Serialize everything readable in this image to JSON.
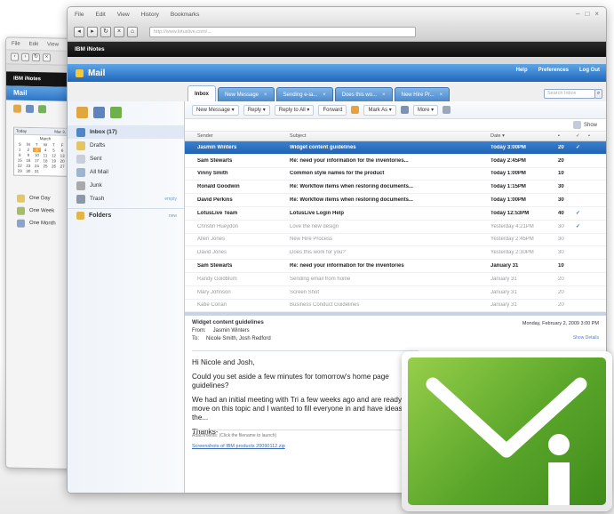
{
  "back_window": {
    "menu": [
      "File",
      "Edit",
      "View"
    ],
    "brand": "IBM iNotes",
    "header": "Mail",
    "date_tab": "Today",
    "date_label": "Mar 3, 20...",
    "calendar_month": "March",
    "calendar_days": [
      "S",
      "M",
      "T",
      "W",
      "T",
      "F",
      "S",
      "1",
      "2",
      "3",
      "4",
      "5",
      "6",
      "7",
      "8",
      "9",
      "10",
      "11",
      "12",
      "13",
      "14",
      "15",
      "16",
      "17",
      "18",
      "19",
      "20",
      "21",
      "22",
      "23",
      "24",
      "25",
      "26",
      "27",
      "28",
      "29",
      "30",
      "31"
    ],
    "views": [
      "One Day",
      "One Week",
      "One Month"
    ]
  },
  "browser": {
    "menu": [
      "File",
      "Edit",
      "View",
      "History",
      "Bookmarks"
    ],
    "url": "http://www.lotuslive.com/..."
  },
  "app": {
    "brand": "IBM iNotes",
    "title": "Mail",
    "util_links": [
      "Help",
      "Preferences",
      "Log Out"
    ],
    "search_placeholder": "Search Inbox"
  },
  "tabs": [
    {
      "label": "Inbox",
      "active": true
    },
    {
      "label": "New Message",
      "active": false
    },
    {
      "label": "Sending e-ia...",
      "active": false
    },
    {
      "label": "Does this wo...",
      "active": false
    },
    {
      "label": "New Hire Pr...",
      "active": false
    }
  ],
  "toolbar": {
    "new_message": "New Message",
    "reply": "Reply",
    "reply_all": "Reply to All",
    "forward": "Forward",
    "mark_as": "Mark As",
    "more": "More",
    "show": "Show"
  },
  "folders": [
    {
      "label": "Inbox (17)",
      "active": true
    },
    {
      "label": "Drafts",
      "active": false
    },
    {
      "label": "Sent",
      "active": false
    },
    {
      "label": "All Mail",
      "active": false
    },
    {
      "label": "Junk",
      "active": false
    },
    {
      "label": "Trash",
      "active": false
    }
  ],
  "trash_extra": "empty",
  "folders_header": "Folders",
  "folders_new": "new",
  "columns": {
    "sender": "Sender",
    "subject": "Subject",
    "date": "Date"
  },
  "messages": [
    {
      "sender": "Jasmin Winters",
      "subject": "Widget content guidelines",
      "date": "Today 3:00PM",
      "size": "20",
      "check": "✓",
      "state": "sel"
    },
    {
      "sender": "Sam Stewarts",
      "subject": "Re: need your information for the inventories...",
      "date": "Today 2:45PM",
      "size": "20",
      "check": "",
      "state": "unread"
    },
    {
      "sender": "Vinny Smith",
      "subject": "Common style names for the product",
      "date": "Today 1:00PM",
      "size": "10",
      "check": "",
      "state": "unread"
    },
    {
      "sender": "Ronald Goodwin",
      "subject": "Re: Workflow items when restoring documents...",
      "date": "Today 1:15PM",
      "size": "30",
      "check": "",
      "state": "unread"
    },
    {
      "sender": "David Perkins",
      "subject": "Re: Workflow items when restoring documents...",
      "date": "Today 1:00PM",
      "size": "30",
      "check": "",
      "state": "unread"
    },
    {
      "sender": "LotusLive Team",
      "subject": "LotusLive Login Help",
      "date": "Today 12:53PM",
      "size": "40",
      "check": "✓",
      "state": "unread"
    },
    {
      "sender": "Christin Hueydon",
      "subject": "Love the new design",
      "date": "Yesterday 4:21PM",
      "size": "30",
      "check": "✓",
      "state": "read"
    },
    {
      "sender": "Allen Jones",
      "subject": "New Hire Process",
      "date": "Yesterday 2:45PM",
      "size": "30",
      "check": "",
      "state": "read"
    },
    {
      "sender": "David Jones",
      "subject": "Does this work for you?",
      "date": "Yesterday 2:30PM",
      "size": "30",
      "check": "",
      "state": "read"
    },
    {
      "sender": "Sam Stewarts",
      "subject": "Re: need your information for the inventories",
      "date": "January 31",
      "size": "10",
      "check": "",
      "state": "unread"
    },
    {
      "sender": "Randy Goldblum",
      "subject": "Sending email from home",
      "date": "January 31",
      "size": "20",
      "check": "",
      "state": "read"
    },
    {
      "sender": "Mary Johnson",
      "subject": "Screen Shot",
      "date": "January 31",
      "size": "20",
      "check": "",
      "state": "read"
    },
    {
      "sender": "Katie Conan",
      "subject": "Business Conduct Guidelines",
      "date": "January 31",
      "size": "20",
      "check": "",
      "state": "read"
    }
  ],
  "preview": {
    "subject": "Widget content guidelines",
    "from_label": "From:",
    "from": "Jasmin Winters",
    "to_label": "To:",
    "to": "Nicole Smith, Josh Redford",
    "date": "Monday, February 2, 2009 3:00 PM",
    "details_link": "Show Details",
    "greeting": "Hi Nicole and Josh,",
    "body1": "Could you set aside a few minutes for tomorrow's home page guidelines?",
    "body2": "We had an initial meeting with Tri a few weeks ago and are ready to move on this topic and I wanted to fill everyone in and have ideas for the...",
    "closing": "Thanks-",
    "attachments_label": "Attachments: (Click the filename to launch)",
    "attachment_file": "Screenshots of IBM products 20090112.zip"
  }
}
